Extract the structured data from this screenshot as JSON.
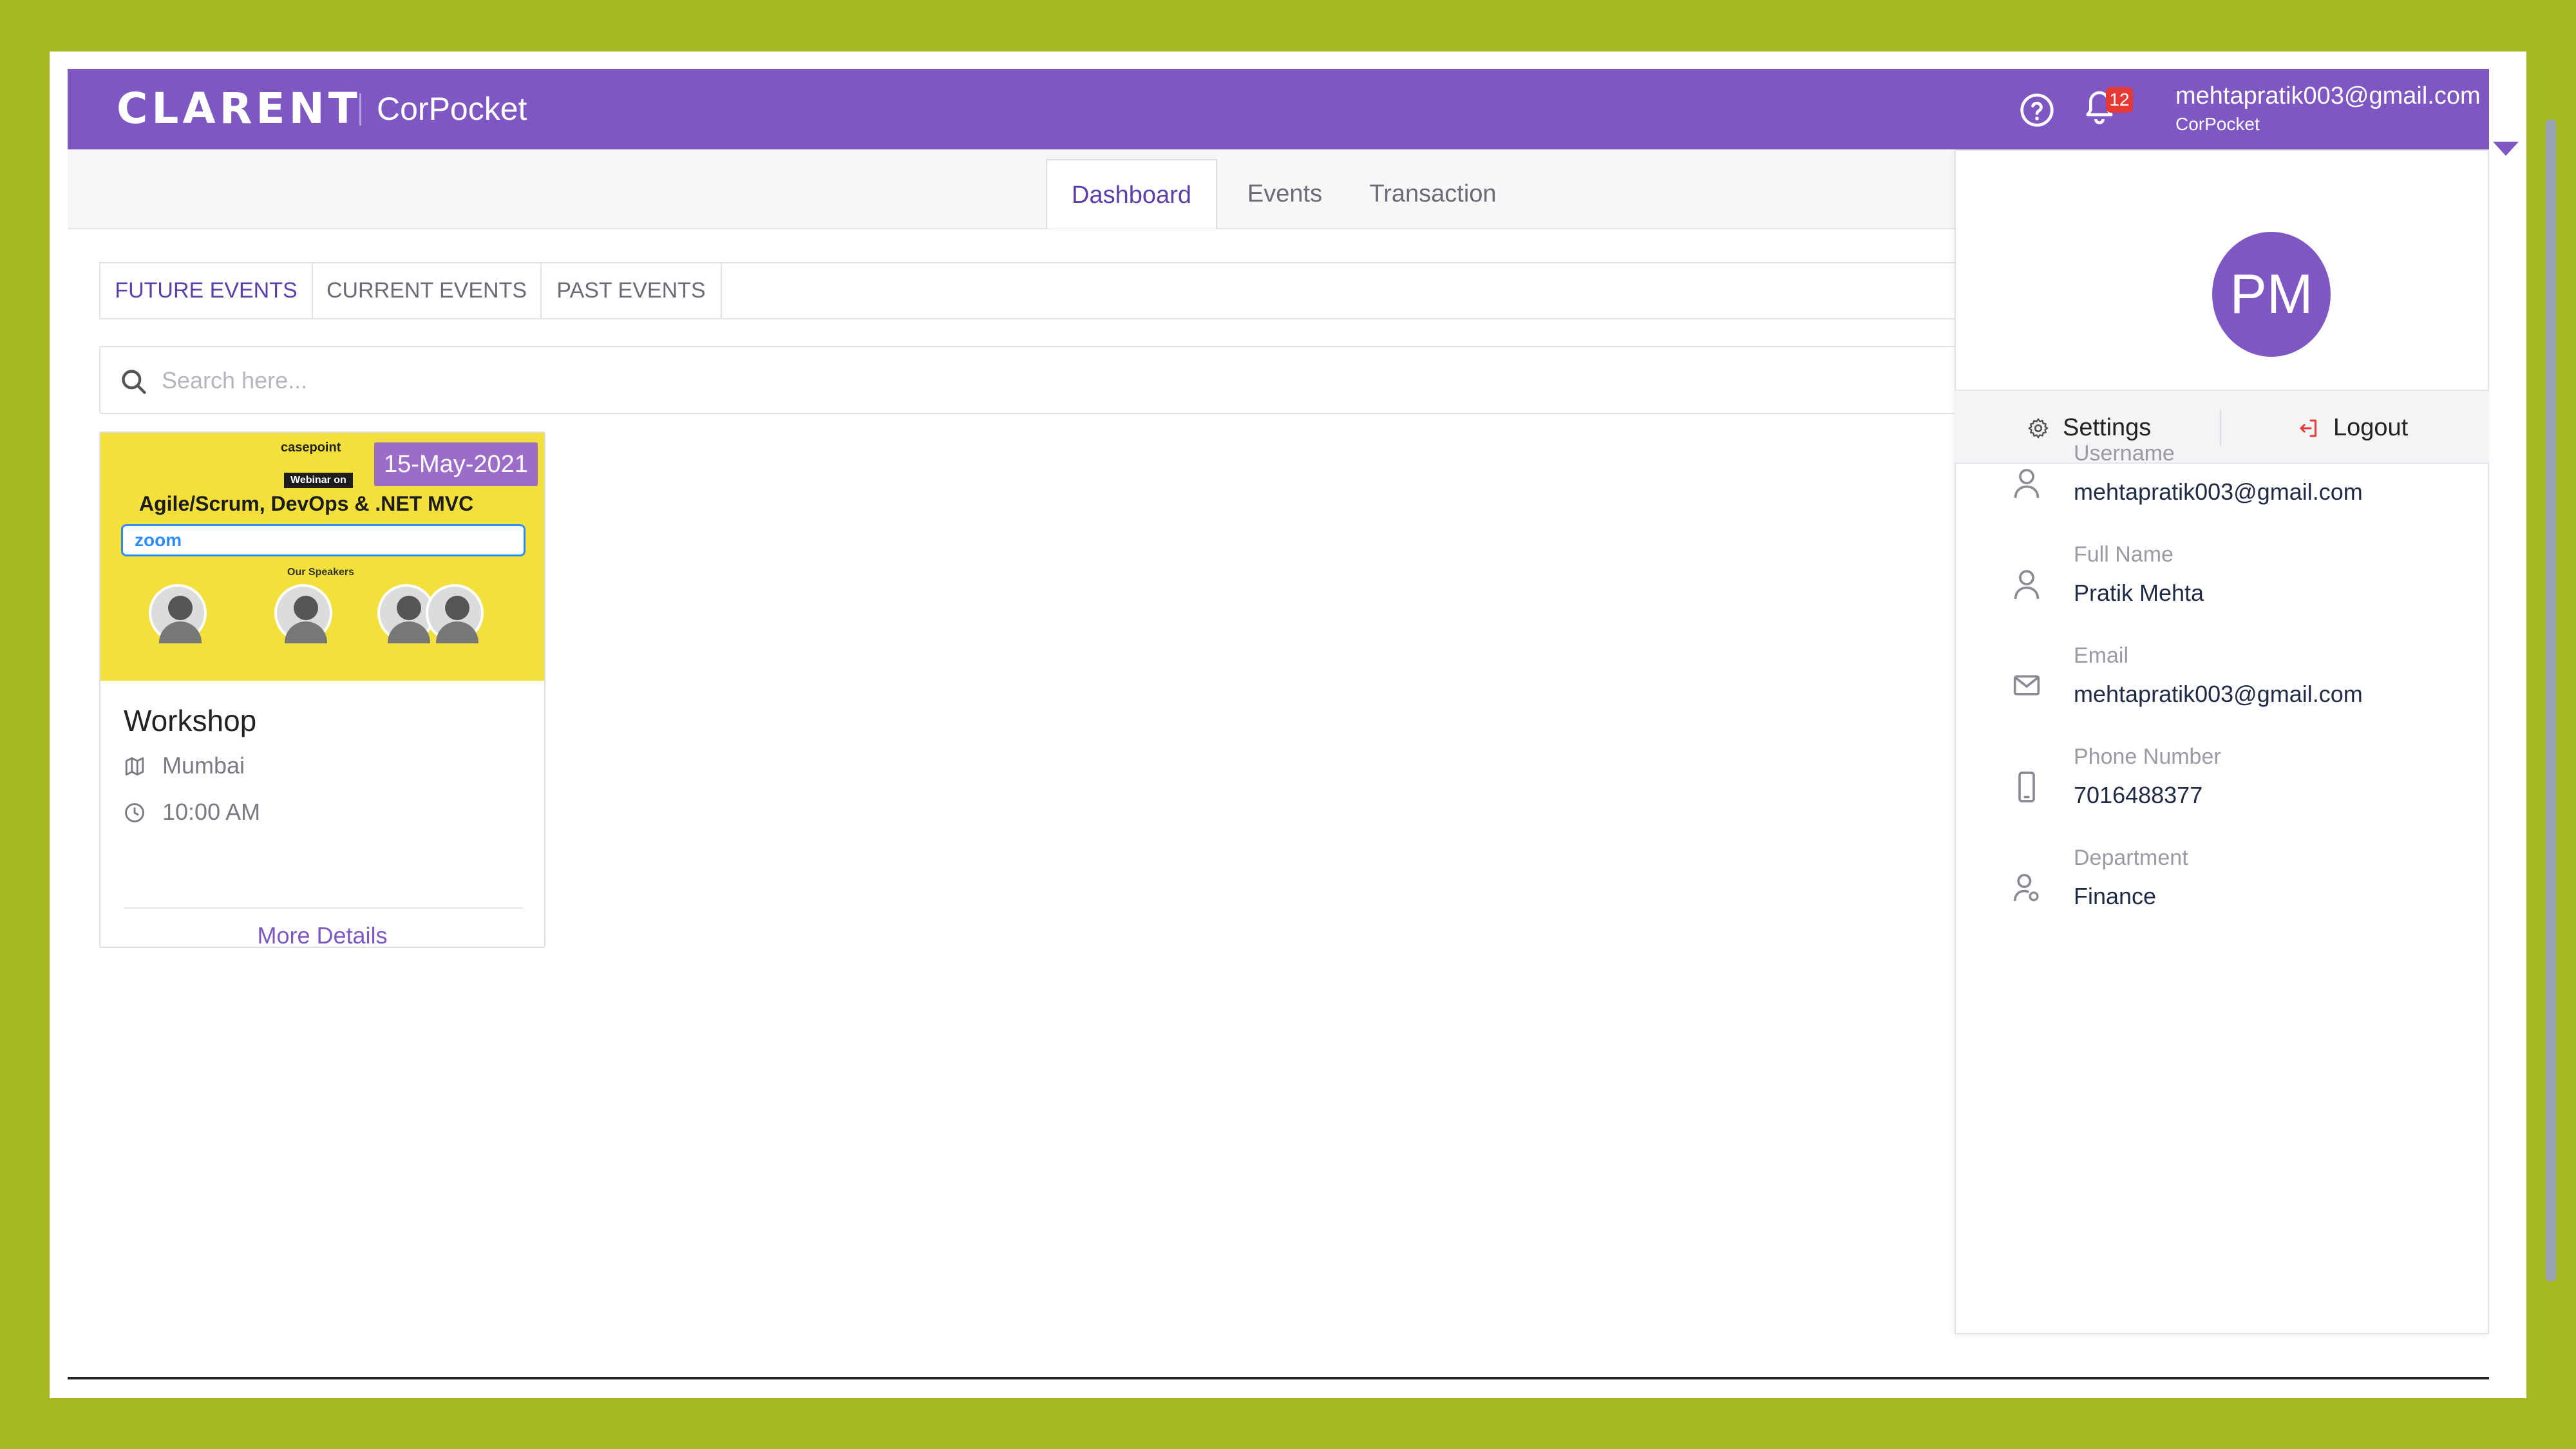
{
  "header": {
    "brand": "CLARENT",
    "app_name": "CorPocket",
    "notification_count": "12",
    "user_email": "mehtapratik003@gmail.com",
    "user_company": "CorPocket"
  },
  "main_tabs": [
    {
      "label": "Dashboard",
      "active": true
    },
    {
      "label": "Events",
      "active": false
    },
    {
      "label": "Transaction",
      "active": false
    }
  ],
  "sub_tabs": [
    {
      "label": "FUTURE EVENTS",
      "active": true
    },
    {
      "label": "CURRENT EVENTS",
      "active": false
    },
    {
      "label": "PAST EVENTS",
      "active": false
    }
  ],
  "search": {
    "placeholder": "Search here..."
  },
  "event_card": {
    "poster": {
      "brand": "casepoint",
      "pill": "Webinar on",
      "title": "Agile/Scrum, DevOps & .NET MVC",
      "zoom": "zoom",
      "speakers_label": "Our Speakers"
    },
    "date": "15-May-2021",
    "title": "Workshop",
    "location": "Mumbai",
    "time": "10:00 AM",
    "more_details": "More Details"
  },
  "profile": {
    "initials": "PM",
    "settings_label": "Settings",
    "logout_label": "Logout",
    "fields": [
      {
        "label": "Username",
        "value": "mehtapratik003@gmail.com",
        "icon": "user-icon"
      },
      {
        "label": "Full Name",
        "value": "Pratik Mehta",
        "icon": "user-icon"
      },
      {
        "label": "Email",
        "value": "mehtapratik003@gmail.com",
        "icon": "mail-icon"
      },
      {
        "label": "Phone Number",
        "value": "7016488377",
        "icon": "phone-icon"
      },
      {
        "label": "Department",
        "value": "Finance",
        "icon": "department-icon"
      }
    ]
  },
  "colors": {
    "background": "#a6b925",
    "header": "#7e57c2",
    "accent": "#5b3fa8",
    "badge": "#e53935",
    "date_badge": "#9c6dc8"
  }
}
